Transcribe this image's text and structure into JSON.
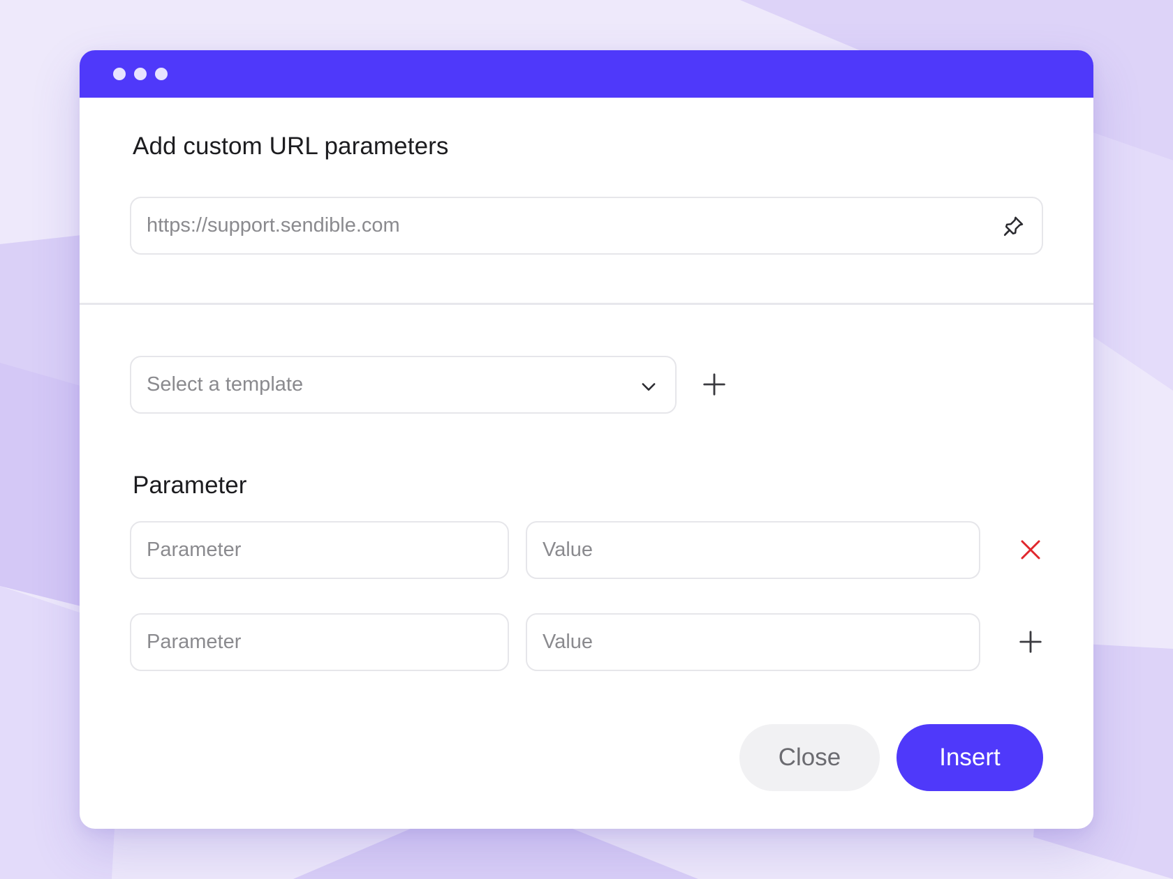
{
  "colors": {
    "accent": "#4f39fa",
    "danger": "#e0262c",
    "background": "#ece6fb"
  },
  "window": {
    "title_dots": [
      "dot",
      "dot",
      "dot"
    ]
  },
  "dialog": {
    "title": "Add custom URL parameters",
    "url_field": {
      "placeholder": "https://support.sendible.com",
      "value": "",
      "icon": "pin-icon"
    },
    "template_select": {
      "placeholder": "Select a template",
      "icon": "chevron-down-icon",
      "add_icon": "plus-icon"
    },
    "parameters": {
      "label": "Parameter",
      "rows": [
        {
          "parameter_placeholder": "Parameter",
          "value_placeholder": "Value",
          "action_icon": "close-icon"
        },
        {
          "parameter_placeholder": "Parameter",
          "value_placeholder": "Value",
          "action_icon": "plus-icon"
        }
      ]
    },
    "buttons": {
      "close_label": "Close",
      "insert_label": "Insert"
    }
  }
}
